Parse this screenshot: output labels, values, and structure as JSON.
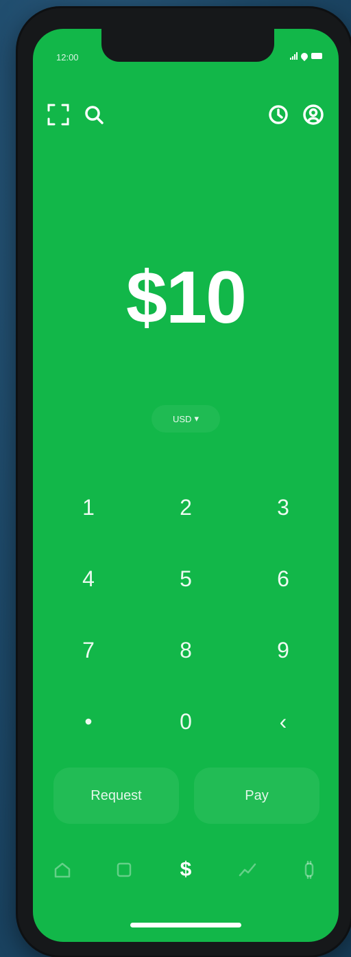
{
  "status_bar": {
    "time": "12:00",
    "signal_icon": "signal-icon",
    "wifi_icon": "wifi-icon",
    "battery_icon": "battery-icon"
  },
  "top_bar": {
    "left_icons": [
      "scan-icon",
      "search-icon"
    ],
    "right_icons": [
      "activity-clock-icon",
      "profile-icon"
    ]
  },
  "amount": {
    "value": "$10"
  },
  "currency": {
    "selected": "USD",
    "indicator": "▾"
  },
  "keypad": {
    "keys": [
      "1",
      "2",
      "3",
      "4",
      "5",
      "6",
      "7",
      "8",
      "9",
      "•",
      "0",
      "‹"
    ]
  },
  "actions": {
    "request_label": "Request",
    "pay_label": "Pay"
  },
  "tab_bar": {
    "tabs": [
      "home-icon",
      "card-icon",
      "dollar-icon",
      "investing-icon",
      "bitcoin-icon"
    ],
    "active_glyph": "$"
  },
  "colors": {
    "brand_green": "#12b749",
    "frame": "#16181a",
    "background": "#1e4a6a",
    "text": "#ffffff"
  }
}
